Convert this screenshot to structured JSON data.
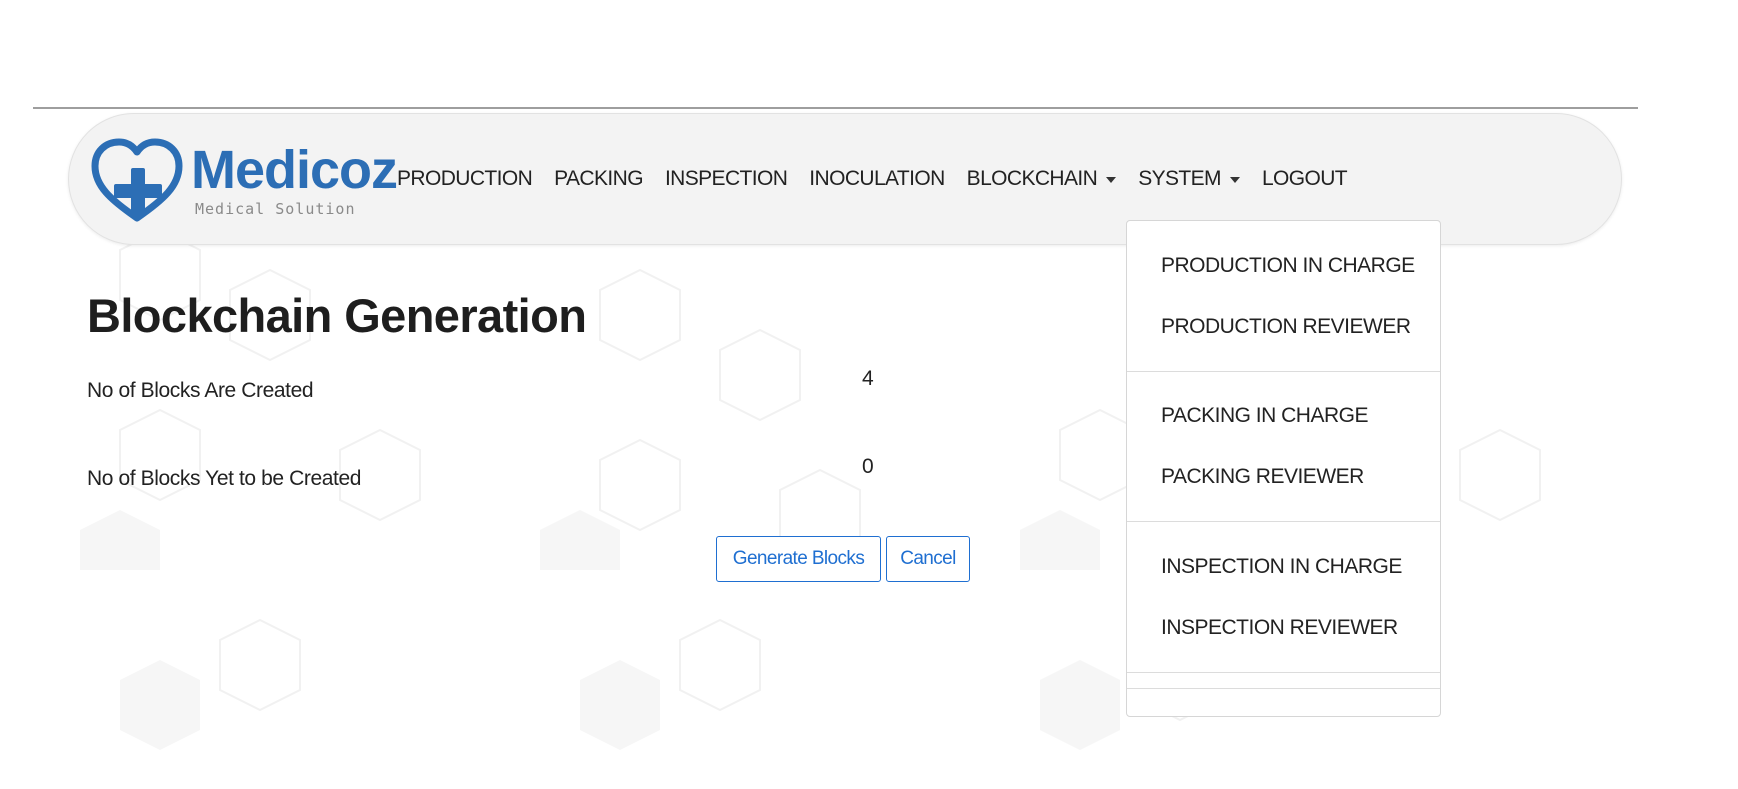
{
  "brand": {
    "name": "Medicoz",
    "tagline": "Medical Solution",
    "primary_color": "#2c6eb5"
  },
  "nav": {
    "items": [
      {
        "label": "PRODUCTION"
      },
      {
        "label": "PACKING"
      },
      {
        "label": "INSPECTION"
      },
      {
        "label": "INOCULATION"
      },
      {
        "label": "BLOCKCHAIN",
        "has_dropdown": true
      },
      {
        "label": "SYSTEM",
        "has_dropdown": true,
        "expanded": true
      },
      {
        "label": "LOGOUT"
      }
    ]
  },
  "system_menu": {
    "groups": [
      [
        "PRODUCTION IN CHARGE",
        "PRODUCTION REVIEWER"
      ],
      [
        "PACKING IN CHARGE",
        "PACKING REVIEWER"
      ],
      [
        "INSPECTION IN CHARGE",
        "INSPECTION REVIEWER"
      ]
    ]
  },
  "page": {
    "title": "Blockchain Generation",
    "rows": [
      {
        "label": "No of Blocks Are Created",
        "value": "4"
      },
      {
        "label": "No of Blocks Yet to be Created",
        "value": "0"
      }
    ]
  },
  "actions": {
    "generate_label": "Generate Blocks",
    "cancel_label": "Cancel",
    "button_color": "#1f6fd1"
  }
}
